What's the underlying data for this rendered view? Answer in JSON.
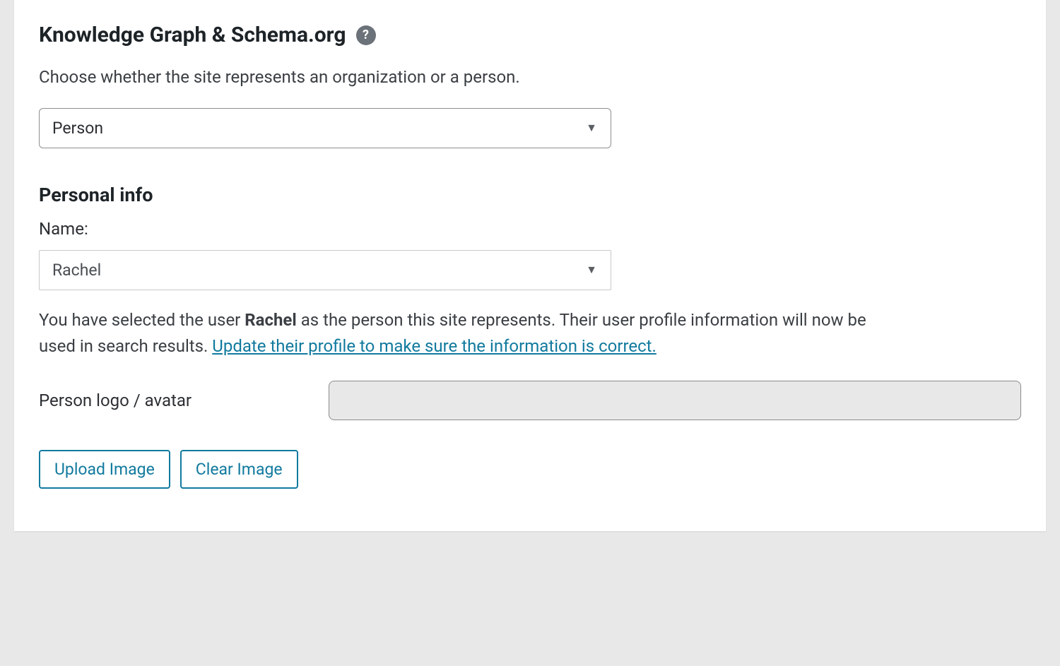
{
  "section": {
    "title": "Knowledge Graph & Schema.org",
    "description": "Choose whether the site represents an organization or a person."
  },
  "entity_select": {
    "value": "Person"
  },
  "personal_info": {
    "heading": "Personal info",
    "name_label": "Name:",
    "name_value": "Rachel",
    "info_prefix": "You have selected the user ",
    "info_bold": "Rachel",
    "info_suffix": " as the person this site represents. Their user profile information will now be used in search results. ",
    "info_link": "Update their profile to make sure the information is correct."
  },
  "avatar": {
    "label": "Person logo / avatar",
    "value": ""
  },
  "buttons": {
    "upload": "Upload Image",
    "clear": "Clear Image"
  }
}
